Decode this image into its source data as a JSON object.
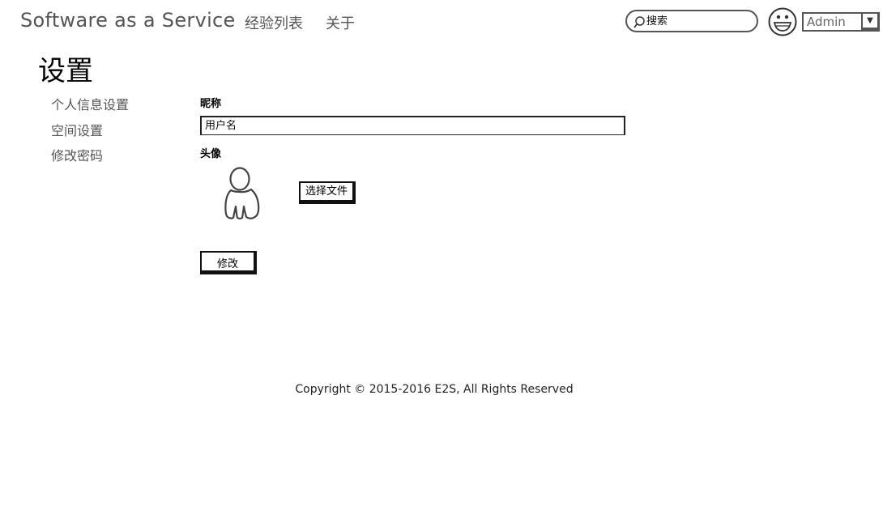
{
  "header": {
    "brand": "Software as a Service",
    "nav": [
      {
        "label": "经验列表"
      },
      {
        "label": "关于"
      }
    ],
    "search": {
      "placeholder": "搜索",
      "icon": "search-icon"
    },
    "user": {
      "avatar_icon": "smiley-face-icon",
      "selected": "Admin",
      "dropdown_icon": "chevron-down-icon"
    }
  },
  "page": {
    "title": "设置"
  },
  "sidebar": {
    "items": [
      {
        "label": "个人信息设置"
      },
      {
        "label": "空间设置"
      },
      {
        "label": "修改密码"
      }
    ]
  },
  "form": {
    "nickname_label": "昵称",
    "nickname_value": "用户名",
    "avatar_label": "头像",
    "avatar_icon": "user-silhouette-icon",
    "choose_file_label": "选择文件",
    "submit_label": "修改"
  },
  "footer": {
    "copyright": "Copyright © 2015-2016 E2S, All Rights Reserved"
  }
}
